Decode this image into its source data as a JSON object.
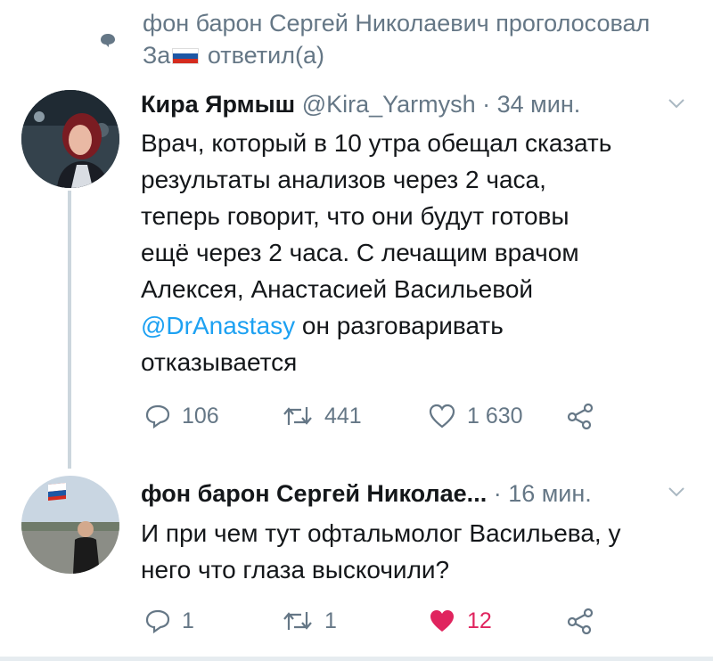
{
  "context": {
    "line1": "фон барон Сергей Николаевич проголосовал",
    "prefix": "За",
    "suffix": "ответил(а)",
    "flag_colors": [
      "#ffffff",
      "#1c57a5",
      "#d52b1e"
    ]
  },
  "tweet1": {
    "name": "Кира Ярмыш",
    "meta": "@Kira_Yarmysh · 34 мин.",
    "lines": [
      "Врач, который в 10 утра обещал сказать",
      "результаты анализов через 2 часа,",
      "теперь говорит, что они будут готовы",
      "ещё через 2 часа. С лечащим врачом",
      "Алексея, Анастасией Васильевой"
    ],
    "mention": "@DrAnastasy",
    "line6_rest": " он разговаривать",
    "line7": "отказывается",
    "replies": "106",
    "retweets": "441",
    "likes": "1 630"
  },
  "tweet2": {
    "name": "фон барон Сергей Николае...",
    "meta": "· 16 мин.",
    "lines": [
      "И при чем тут офтальмолог Васильева, у",
      "него что глаза выскочили?"
    ],
    "replies": "1",
    "retweets": "1",
    "likes": "12"
  },
  "colors": {
    "accent": "#1da1f2",
    "like": "#e0245e",
    "muted": "#657786"
  }
}
